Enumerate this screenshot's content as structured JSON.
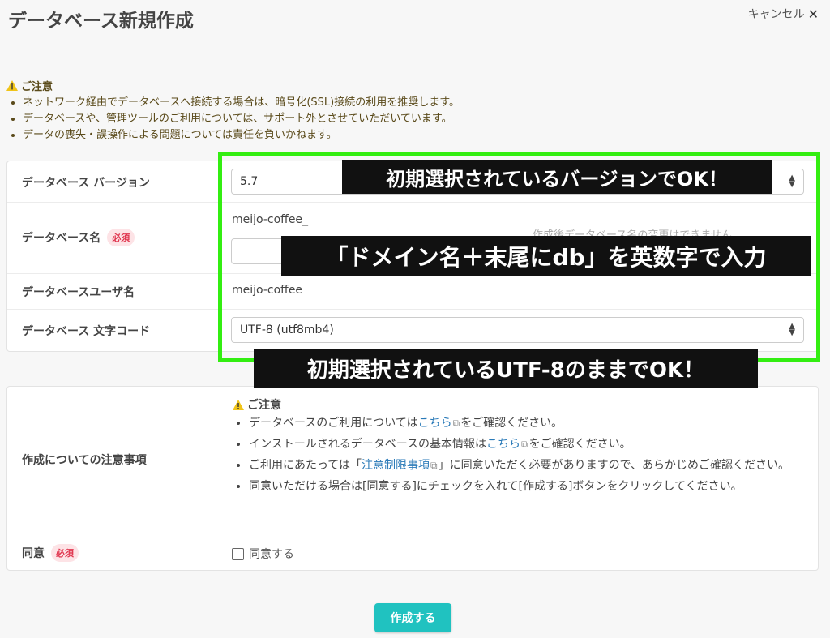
{
  "page": {
    "title": "データベース新規作成",
    "cancel_label": "キャンセル"
  },
  "notice": {
    "heading": "ご注意",
    "items": [
      "ネットワーク経由でデータベースへ接続する場合は、暗号化(SSL)接続の利用を推奨します。",
      "データベースや、管理ツールのご利用については、サポート外とさせていただいています。",
      "データの喪失・誤操作による問題については責任を負いかねます。"
    ]
  },
  "form": {
    "version": {
      "label": "データベース バージョン",
      "value": "5.7"
    },
    "db_name": {
      "label": "データベース名",
      "required": "必須",
      "prefix": "meijo-coffee_",
      "value": "",
      "hint": "作成後データベース名の変更はできません"
    },
    "db_user": {
      "label": "データベースユーザ名",
      "value": "meijo-coffee"
    },
    "charset": {
      "label": "データベース 文字コード",
      "value": "UTF-8 (utf8mb4)"
    }
  },
  "terms": {
    "label": "作成についての注意事項",
    "heading": "ご注意",
    "item1_pre": "データベースのご利用については",
    "item1_link": "こちら",
    "item1_post": "をご確認ください。",
    "item2_pre": "インストールされるデータベースの基本情報は",
    "item2_link": "こちら",
    "item2_post": "をご確認ください。",
    "item3_pre": "ご利用にあたっては「",
    "item3_link": "注意制限事項",
    "item3_post": "」に同意いただく必要がありますので、あらかじめご確認ください。",
    "item4": "同意いただける場合は[同意する]にチェックを入れて[作成する]ボタンをクリックしてください。"
  },
  "agree": {
    "label": "同意",
    "required": "必須",
    "checkbox_label": "同意する",
    "checked": false
  },
  "submit_label": "作成する",
  "annotations": {
    "callout1": "初期選択されているバージョンでOK！",
    "callout2": "「ドメイン名＋末尾にdb」を英数字で入力",
    "callout3": "初期選択されているUTF-8のままでOK！",
    "highlight_color": "#33ee11"
  }
}
